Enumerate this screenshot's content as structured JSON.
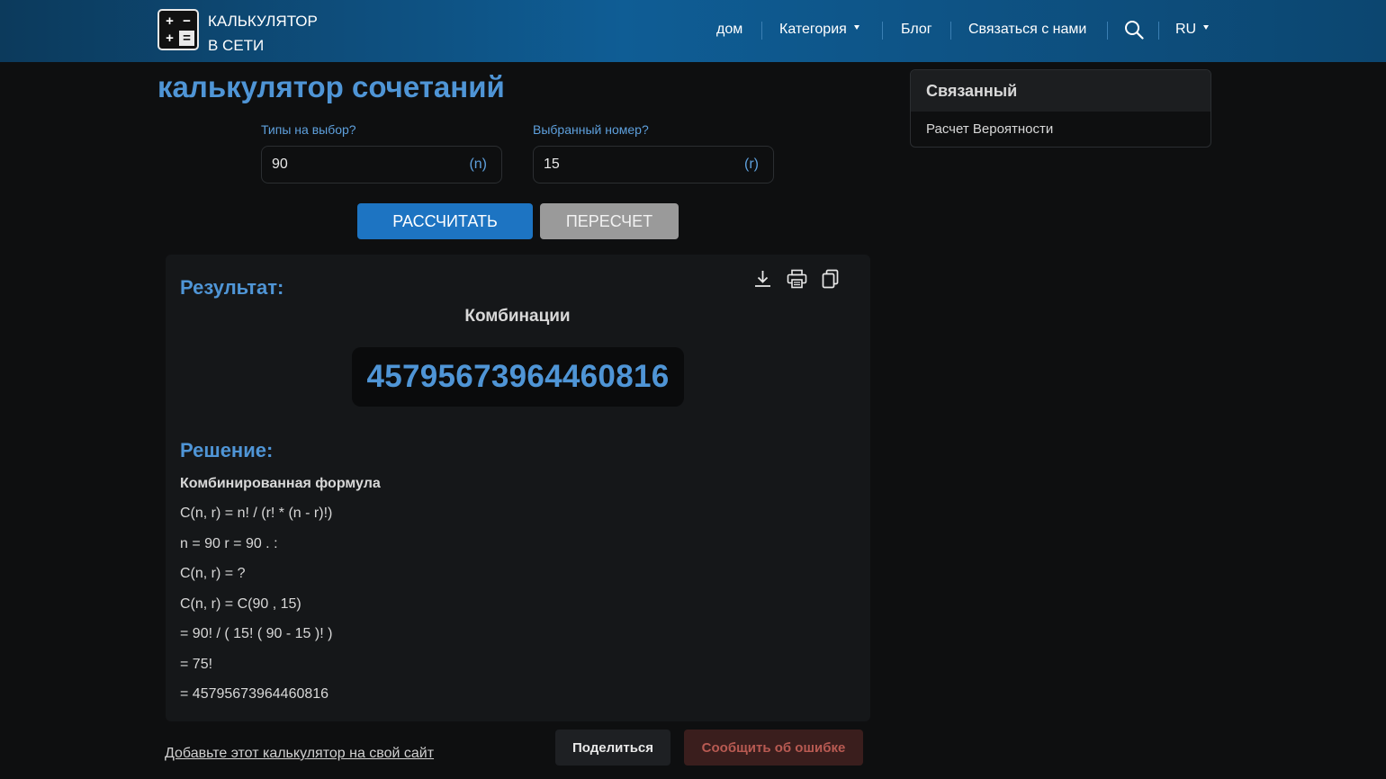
{
  "header": {
    "brand_line1": "КАЛЬКУЛЯТОР",
    "brand_line2": "В СЕТИ",
    "logo_glyphs": [
      "+",
      "−",
      "+",
      "="
    ],
    "nav": {
      "home": "дом",
      "category": "Категория",
      "blog": "Блог",
      "contact": "Связаться с нами",
      "language": "RU"
    }
  },
  "main": {
    "title": "калькулятор сочетаний",
    "fields": {
      "n_label": "Типы на выбор?",
      "n_value": "90",
      "n_suffix": "(n)",
      "r_label": "Выбранный номер?",
      "r_value": "15",
      "r_suffix": "(r)"
    },
    "buttons": {
      "calculate": "РАССЧИТАТЬ",
      "reset": "ПЕРЕСЧЕТ"
    },
    "result": {
      "title": "Результат:",
      "caption": "Комбинации",
      "value": "45795673964460816"
    },
    "solution": {
      "title": "Решение:",
      "formula_title": "Комбинированная формула",
      "steps": [
        "C(n, r) = n! / (r! * (n - r)!)",
        "n = 90 r = 90 . :",
        "C(n, r) = ?",
        "C(n, r) = C(90 , 15)",
        "= 90! / ( 15! ( 90 - 15 )! )",
        "= 75!",
        "= 45795673964460816"
      ]
    },
    "footer": {
      "add_link": "Добавьте этот калькулятор на свой сайт",
      "share": "Поделиться",
      "report": "Сообщить об ошибке"
    }
  },
  "sidebar": {
    "title": "Связанный",
    "items": [
      "Расчет Вероятности"
    ]
  },
  "colors": {
    "accent": "#4f95d6",
    "primary_button": "#1d74c2",
    "header_blue": "#0f5d95",
    "report_text": "#b85a52"
  }
}
